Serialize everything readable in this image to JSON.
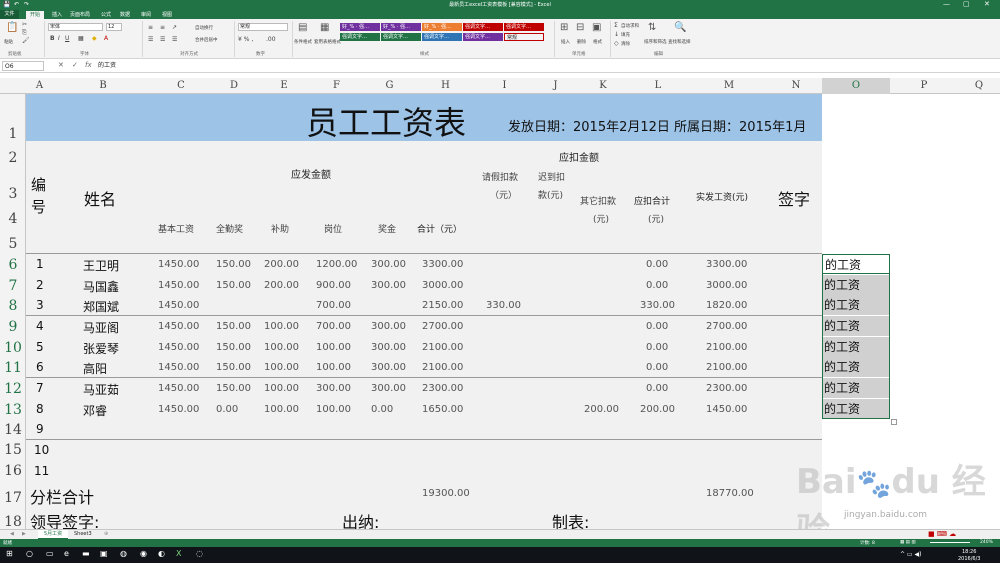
{
  "window": {
    "title": "最新员工excel工资表模板 [兼容模式] - Excel"
  },
  "ribbon": {
    "tabs": [
      "文件",
      "开始",
      "插入",
      "页面布局",
      "公式",
      "数据",
      "审阅",
      "视图"
    ],
    "font_name": "宋体",
    "font_size": "12",
    "number_format": "常规",
    "groups": [
      "剪贴板",
      "字体",
      "对齐方式",
      "数字",
      "样式",
      "单元格",
      "编辑"
    ],
    "labels": {
      "paste": "粘贴",
      "wrap": "自动换行",
      "merge": "合并后居中",
      "cond": "条件格式",
      "table": "套用表格格式",
      "insert": "插入",
      "delete": "删除",
      "format": "格式",
      "autosum": "自动求和",
      "fill": "填充",
      "clear": "清除",
      "sort": "排序和筛选",
      "find": "查找和选择"
    },
    "styles": [
      {
        "text": "好_% · 强…",
        "color": "#7030a0"
      },
      {
        "text": "好_% · 强…",
        "color": "#7030a0"
      },
      {
        "text": "好_% · 强…",
        "color": "#ed7d31"
      },
      {
        "text": "强调文字…",
        "color": "#c00000"
      },
      {
        "text": "强调文字…",
        "color": "#217346"
      },
      {
        "text": "强调文字…",
        "color": "#217346"
      },
      {
        "text": "强调文字…",
        "color": "#2f75b5"
      },
      {
        "text": "强调文字…",
        "color": "#7030a0"
      },
      {
        "text": "强调文字…",
        "color": "#c00000"
      },
      {
        "text": "常规",
        "color": "#ffffff"
      }
    ]
  },
  "formula_bar": {
    "name_box": "O6",
    "formula": "的工资"
  },
  "columns": [
    "A",
    "B",
    "C",
    "D",
    "E",
    "F",
    "G",
    "H",
    "I",
    "J",
    "K",
    "L",
    "M",
    "N",
    "O",
    "P",
    "Q"
  ],
  "rows": [
    "1",
    "2",
    "3",
    "4",
    "5",
    "6",
    "7",
    "8",
    "9",
    "10",
    "11",
    "12",
    "13",
    "14",
    "15",
    "16",
    "17",
    "18"
  ],
  "sheet": {
    "title": "员工工资表",
    "date_text": "发放日期：2015年2月12日 所属日期：2015年1月",
    "headers": {
      "no": "编号",
      "name": "姓名",
      "income": "应发金额",
      "deduct": "应扣金额",
      "base": "基本工资",
      "attend": "全勤奖",
      "subsidy": "补助",
      "post": "岗位",
      "bonus": "奖金",
      "total": "合计（元）",
      "leave": "请假扣款",
      "leave_unit": "（元）",
      "late": "迟到扣",
      "late2": "款(元)",
      "other": "其它扣款",
      "other_unit": "(元)",
      "dtotal": "应扣合计",
      "dtotal_unit": "(元)",
      "net": "实发工资(元)",
      "sign": "签字"
    },
    "employees": [
      {
        "no": "1",
        "name": "王卫明",
        "base": "1450.00",
        "attend": "150.00",
        "subsidy": "200.00",
        "post": "1200.00",
        "bonus": "300.00",
        "total": "3300.00",
        "leave": "",
        "other": "",
        "dtotal": "0.00",
        "net": "3300.00"
      },
      {
        "no": "2",
        "name": "马国鑫",
        "base": "1450.00",
        "attend": "150.00",
        "subsidy": "200.00",
        "post": "900.00",
        "bonus": "300.00",
        "total": "3000.00",
        "leave": "",
        "other": "",
        "dtotal": "0.00",
        "net": "3000.00"
      },
      {
        "no": "3",
        "name": "郑国斌",
        "base": "1450.00",
        "attend": "",
        "subsidy": "",
        "post": "700.00",
        "bonus": "",
        "total": "2150.00",
        "leave": "330.00",
        "other": "",
        "dtotal": "330.00",
        "net": "1820.00"
      },
      {
        "no": "4",
        "name": "马亚阁",
        "base": "1450.00",
        "attend": "150.00",
        "subsidy": "100.00",
        "post": "700.00",
        "bonus": "300.00",
        "total": "2700.00",
        "leave": "",
        "other": "",
        "dtotal": "0.00",
        "net": "2700.00"
      },
      {
        "no": "5",
        "name": "张爱琴",
        "base": "1450.00",
        "attend": "150.00",
        "subsidy": "100.00",
        "post": "100.00",
        "bonus": "300.00",
        "total": "2100.00",
        "leave": "",
        "other": "",
        "dtotal": "0.00",
        "net": "2100.00"
      },
      {
        "no": "6",
        "name": "高阳",
        "base": "1450.00",
        "attend": "150.00",
        "subsidy": "100.00",
        "post": "100.00",
        "bonus": "300.00",
        "total": "2100.00",
        "leave": "",
        "other": "",
        "dtotal": "0.00",
        "net": "2100.00"
      },
      {
        "no": "7",
        "name": "马亚茹",
        "base": "1450.00",
        "attend": "150.00",
        "subsidy": "100.00",
        "post": "300.00",
        "bonus": "300.00",
        "total": "2300.00",
        "leave": "",
        "other": "",
        "dtotal": "0.00",
        "net": "2300.00"
      },
      {
        "no": "8",
        "name": "邓睿",
        "base": "1450.00",
        "attend": "0.00",
        "subsidy": "100.00",
        "post": "100.00",
        "bonus": "0.00",
        "total": "1650.00",
        "leave": "",
        "other": "200.00",
        "dtotal": "200.00",
        "net": "1450.00"
      }
    ],
    "extra_no": [
      "9",
      "10",
      "11"
    ],
    "subtotal_label": "分栏合计",
    "subtotal_total": "19300.00",
    "subtotal_net": "18770.00",
    "sign_leader": "领导签字:",
    "sign_cashier": "出纳:",
    "sign_maker": "制表:",
    "o_column": [
      "的工资",
      "的工资",
      "的工资",
      "的工资",
      "的工资",
      "的工资",
      "的工资",
      "的工资"
    ]
  },
  "sheet_tabs": [
    "5月工资",
    "Sheet3"
  ],
  "status": {
    "left": "就绪",
    "count": "计数: 8",
    "zoom": "240%"
  },
  "watermark": "jingyan.baidu.com",
  "clock": {
    "time": "18:26",
    "date": "2016/6/3"
  }
}
